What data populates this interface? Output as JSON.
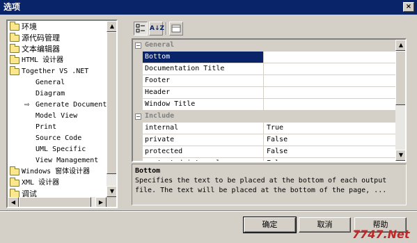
{
  "window": {
    "title": "选项",
    "close_glyph": "×"
  },
  "tree": {
    "items": [
      {
        "label": "环境",
        "level": 0,
        "icon": "folder-icon"
      },
      {
        "label": "源代码管理",
        "level": 0,
        "icon": "folder-icon"
      },
      {
        "label": "文本编辑器",
        "level": 0,
        "icon": "folder-icon"
      },
      {
        "label": "HTML 设计器",
        "level": 0,
        "icon": "folder-icon"
      },
      {
        "label": "Together VS .NET",
        "level": 0,
        "icon": "folder-open-icon"
      },
      {
        "label": "General",
        "level": 1
      },
      {
        "label": "Diagram",
        "level": 1
      },
      {
        "label": "Generate Document",
        "level": 1,
        "selected": true
      },
      {
        "label": "Model View",
        "level": 1
      },
      {
        "label": "Print",
        "level": 1
      },
      {
        "label": "Source Code",
        "level": 1
      },
      {
        "label": "UML Specific",
        "level": 1
      },
      {
        "label": "View Management",
        "level": 1
      },
      {
        "label": "Windows 窗体设计器",
        "level": 0,
        "icon": "folder-icon"
      },
      {
        "label": "XML 设计器",
        "level": 0,
        "icon": "folder-icon"
      },
      {
        "label": "调试",
        "level": 0,
        "icon": "folder-icon"
      }
    ]
  },
  "toolbar": {
    "categorized_icon": "categorized-icon",
    "alphabetical_label": "A↓Z",
    "pages_icon": "property-pages-icon"
  },
  "grid": {
    "rows": [
      {
        "type": "category",
        "name": "General",
        "expander": "−"
      },
      {
        "type": "prop",
        "name": "Bottom",
        "value": "",
        "selected": true
      },
      {
        "type": "prop",
        "name": "Documentation Title",
        "value": ""
      },
      {
        "type": "prop",
        "name": "Footer",
        "value": ""
      },
      {
        "type": "prop",
        "name": "Header",
        "value": ""
      },
      {
        "type": "prop",
        "name": "Window Title",
        "value": ""
      },
      {
        "type": "category",
        "name": "Include",
        "expander": "−"
      },
      {
        "type": "prop",
        "name": "internal",
        "value": "True"
      },
      {
        "type": "prop",
        "name": "private",
        "value": "False"
      },
      {
        "type": "prop",
        "name": "protected",
        "value": "False"
      },
      {
        "type": "prop",
        "name": "protected internal",
        "value": "False"
      }
    ]
  },
  "description": {
    "title": "Bottom",
    "text": "Specifies the text to be placed at the bottom of each output file. The text will be placed at the bottom of the page, ..."
  },
  "buttons": {
    "ok": "确定",
    "cancel": "取消",
    "help": "帮助"
  },
  "watermark": "7747.Net"
}
